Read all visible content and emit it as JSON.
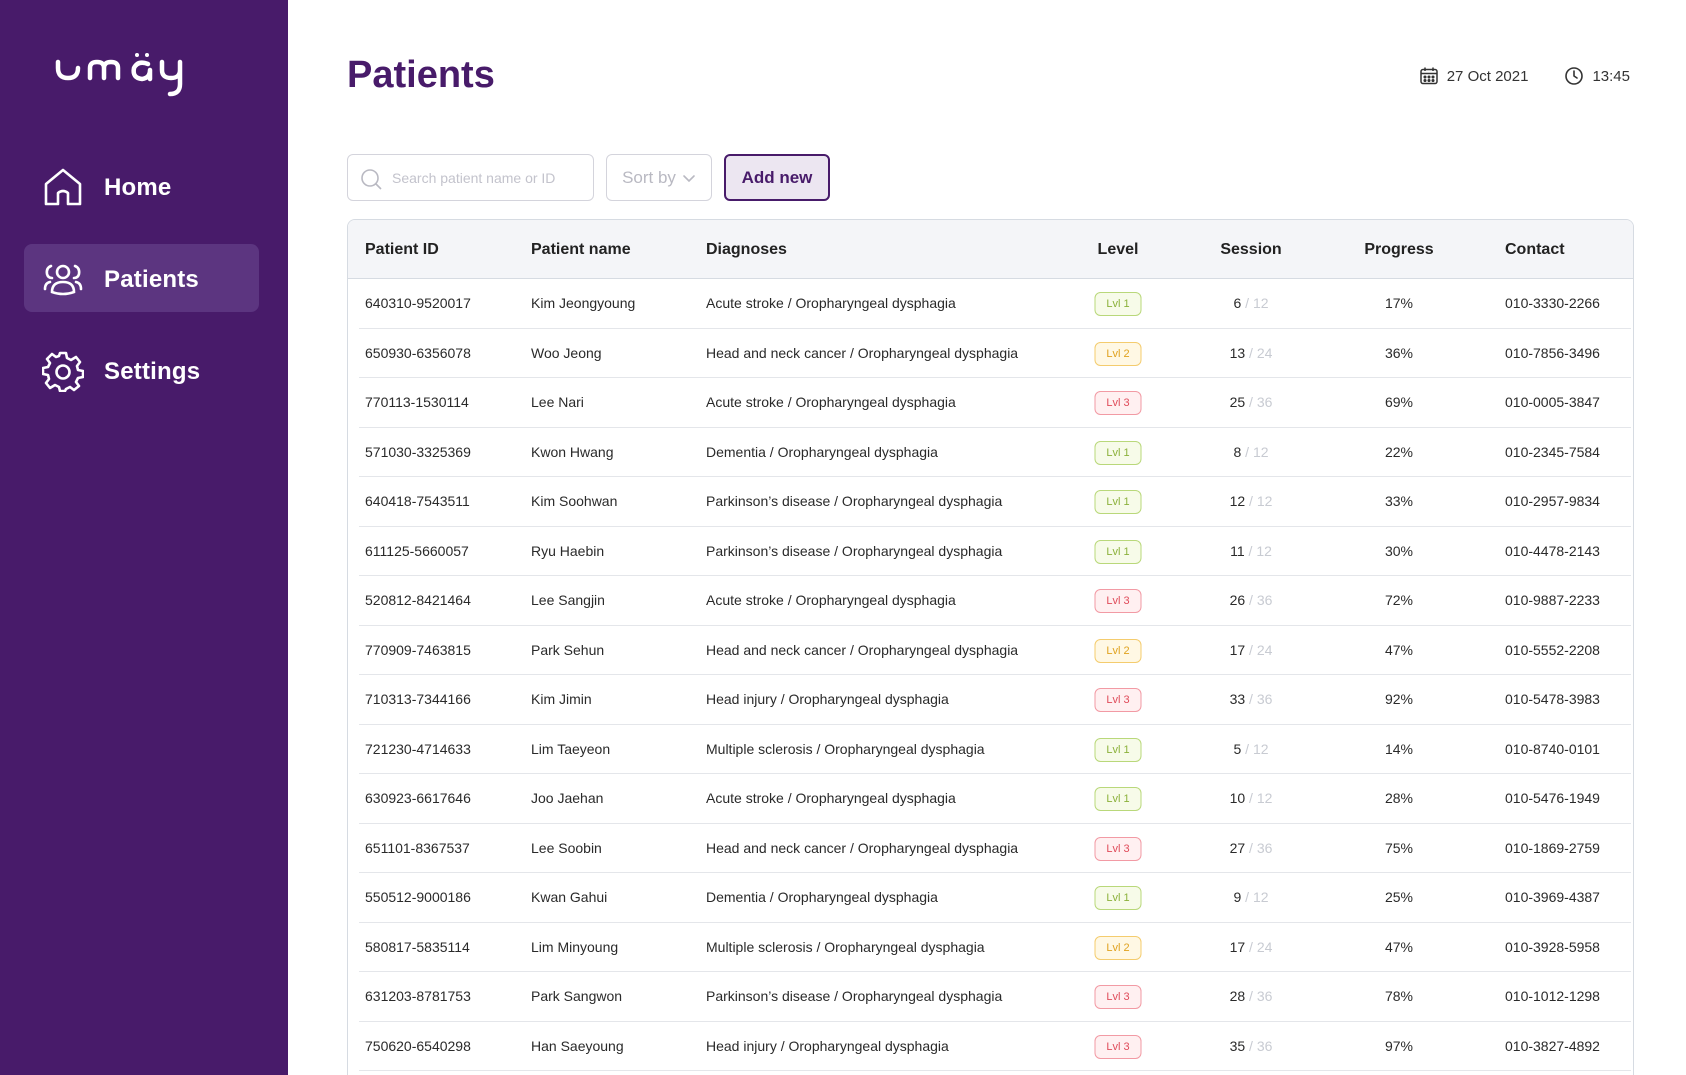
{
  "brand": {
    "logo_text": "umäy",
    "sidebar_color": "#481b6a",
    "accent": "#481b6a"
  },
  "nav": {
    "items": [
      {
        "label": "Home",
        "icon": "home-icon",
        "active": false
      },
      {
        "label": "Patients",
        "icon": "users-icon",
        "active": true
      },
      {
        "label": "Settings",
        "icon": "gear-icon",
        "active": false
      }
    ]
  },
  "header": {
    "title": "Patients",
    "date": "27 Oct 2021",
    "time": "13:45"
  },
  "toolbar": {
    "search_placeholder": "Search patient name or ID",
    "sort_label": "Sort by",
    "add_label": "Add new"
  },
  "table": {
    "columns": [
      "Patient ID",
      "Patient name",
      "Diagnoses",
      "Level",
      "Session",
      "Progress",
      "Contact"
    ],
    "rows": [
      {
        "id": "640310-9520017",
        "name": "Kim Jeongyoung",
        "diagnosis": "Acute stroke / Oropharyngeal dysphagia",
        "level": "Lvl 1",
        "level_num": 1,
        "session_done": "6",
        "session_total": "/ 12",
        "progress": "17%",
        "contact": "010-3330-2266"
      },
      {
        "id": "650930-6356078",
        "name": "Woo Jeong",
        "diagnosis": "Head and neck cancer / Oropharyngeal dysphagia",
        "level": "Lvl 2",
        "level_num": 2,
        "session_done": "13",
        "session_total": "/ 24",
        "progress": "36%",
        "contact": "010-7856-3496"
      },
      {
        "id": "770113-1530114",
        "name": "Lee Nari",
        "diagnosis": "Acute stroke / Oropharyngeal dysphagia",
        "level": "Lvl 3",
        "level_num": 3,
        "session_done": "25",
        "session_total": "/ 36",
        "progress": "69%",
        "contact": "010-0005-3847"
      },
      {
        "id": "571030-3325369",
        "name": "Kwon Hwang",
        "diagnosis": "Dementia / Oropharyngeal dysphagia",
        "level": "Lvl 1",
        "level_num": 1,
        "session_done": "8",
        "session_total": "/ 12",
        "progress": "22%",
        "contact": "010-2345-7584"
      },
      {
        "id": "640418-7543511",
        "name": "Kim Soohwan",
        "diagnosis": "Parkinson’s disease / Oropharyngeal dysphagia",
        "level": "Lvl 1",
        "level_num": 1,
        "session_done": "12",
        "session_total": "/ 12",
        "progress": "33%",
        "contact": "010-2957-9834"
      },
      {
        "id": "611125-5660057",
        "name": "Ryu Haebin",
        "diagnosis": "Parkinson’s disease / Oropharyngeal dysphagia",
        "level": "Lvl 1",
        "level_num": 1,
        "session_done": "11",
        "session_total": "/ 12",
        "progress": "30%",
        "contact": "010-4478-2143"
      },
      {
        "id": "520812-8421464",
        "name": "Lee Sangjin",
        "diagnosis": "Acute stroke / Oropharyngeal dysphagia",
        "level": "Lvl 3",
        "level_num": 3,
        "session_done": "26",
        "session_total": "/ 36",
        "progress": "72%",
        "contact": "010-9887-2233"
      },
      {
        "id": "770909-7463815",
        "name": "Park Sehun",
        "diagnosis": "Head and neck cancer / Oropharyngeal dysphagia",
        "level": "Lvl 2",
        "level_num": 2,
        "session_done": "17",
        "session_total": "/ 24",
        "progress": "47%",
        "contact": "010-5552-2208"
      },
      {
        "id": "710313-7344166",
        "name": "Kim Jimin",
        "diagnosis": "Head injury / Oropharyngeal dysphagia",
        "level": "Lvl 3",
        "level_num": 3,
        "session_done": "33",
        "session_total": "/ 36",
        "progress": "92%",
        "contact": "010-5478-3983"
      },
      {
        "id": "721230-4714633",
        "name": "Lim Taeyeon",
        "diagnosis": "Multiple sclerosis / Oropharyngeal dysphagia",
        "level": "Lvl 1",
        "level_num": 1,
        "session_done": "5",
        "session_total": "/ 12",
        "progress": "14%",
        "contact": "010-8740-0101"
      },
      {
        "id": "630923-6617646",
        "name": "Joo Jaehan",
        "diagnosis": "Acute stroke / Oropharyngeal dysphagia",
        "level": "Lvl 1",
        "level_num": 1,
        "session_done": "10",
        "session_total": "/ 12",
        "progress": "28%",
        "contact": "010-5476-1949"
      },
      {
        "id": "651101-8367537",
        "name": "Lee Soobin",
        "diagnosis": "Head and neck cancer / Oropharyngeal dysphagia",
        "level": "Lvl 3",
        "level_num": 3,
        "session_done": "27",
        "session_total": "/ 36",
        "progress": "75%",
        "contact": "010-1869-2759"
      },
      {
        "id": "550512-9000186",
        "name": "Kwan Gahui",
        "diagnosis": "Dementia / Oropharyngeal dysphagia",
        "level": "Lvl 1",
        "level_num": 1,
        "session_done": "9",
        "session_total": "/ 12",
        "progress": "25%",
        "contact": "010-3969-4387"
      },
      {
        "id": "580817-5835114",
        "name": "Lim Minyoung",
        "diagnosis": "Multiple sclerosis / Oropharyngeal dysphagia",
        "level": "Lvl 2",
        "level_num": 2,
        "session_done": "17",
        "session_total": "/ 24",
        "progress": "47%",
        "contact": "010-3928-5958"
      },
      {
        "id": "631203-8781753",
        "name": "Park Sangwon",
        "diagnosis": "Parkinson’s disease / Oropharyngeal dysphagia",
        "level": "Lvl 3",
        "level_num": 3,
        "session_done": "28",
        "session_total": "/ 36",
        "progress": "78%",
        "contact": "010-1012-1298"
      },
      {
        "id": "750620-6540298",
        "name": "Han Saeyoung",
        "diagnosis": "Head injury / Oropharyngeal dysphagia",
        "level": "Lvl 3",
        "level_num": 3,
        "session_done": "35",
        "session_total": "/ 36",
        "progress": "97%",
        "contact": "010-3827-4892"
      }
    ]
  },
  "colors": {
    "level_1": "#8bb13a",
    "level_2": "#e0a21f",
    "level_3": "#e04b5a"
  }
}
